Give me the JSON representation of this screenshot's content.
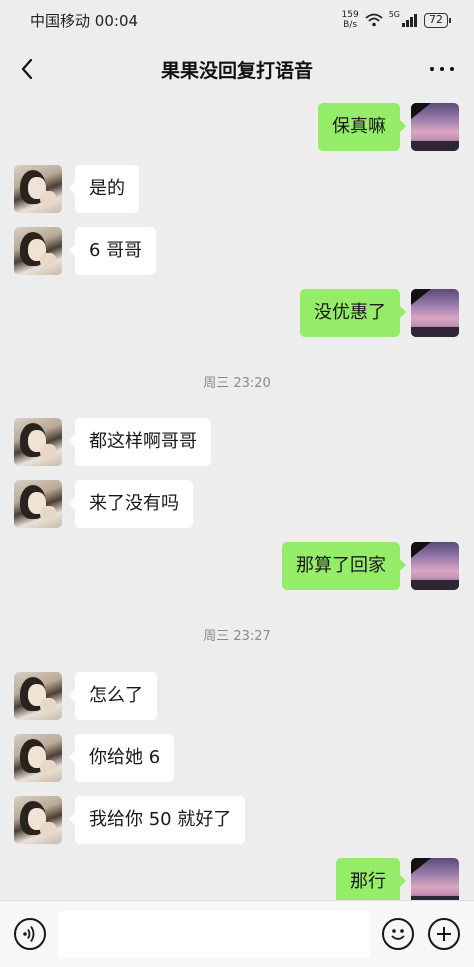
{
  "status_bar": {
    "carrier": "中国移动",
    "time": "00:04",
    "net_speed_value": "159",
    "net_speed_unit": "B/s",
    "network_type": "5G",
    "battery": "72"
  },
  "header": {
    "title": "果果没回复打语音",
    "back_icon": "chevron-left-icon",
    "more_icon": "more-dots-icon"
  },
  "messages": [
    {
      "side": "out",
      "text": "保真嘛"
    },
    {
      "side": "in",
      "text": "是的"
    },
    {
      "side": "in",
      "text": "6 哥哥"
    },
    {
      "side": "out",
      "text": "没优惠了"
    },
    {
      "side": "time",
      "text": "周三 23:20"
    },
    {
      "side": "in",
      "text": "都这样啊哥哥"
    },
    {
      "side": "in",
      "text": "来了没有吗"
    },
    {
      "side": "out",
      "text": "那算了回家"
    },
    {
      "side": "time",
      "text": "周三 23:27"
    },
    {
      "side": "in",
      "text": "怎么了"
    },
    {
      "side": "in",
      "text": "你给她 6"
    },
    {
      "side": "in",
      "text": "我给你 50 就好了"
    },
    {
      "side": "out",
      "text": "那行"
    }
  ],
  "input_bar": {
    "voice_icon": "voice-icon",
    "input_value": "",
    "emoji_icon": "emoji-icon",
    "plus_icon": "plus-icon"
  },
  "colors": {
    "background": "#ededed",
    "outgoing_bubble": "#95ec69",
    "incoming_bubble": "#ffffff",
    "timestamp_text": "#8a8a8a"
  }
}
